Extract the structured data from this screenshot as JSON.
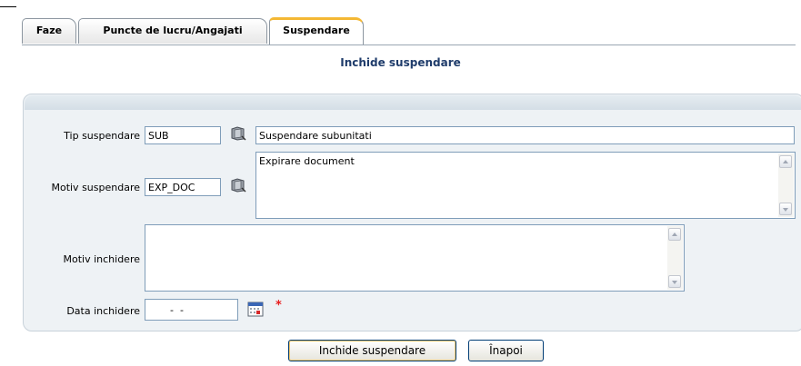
{
  "tabs": [
    {
      "label": "Faze",
      "active": false
    },
    {
      "label": "Puncte de lucru/Angajati",
      "active": false
    },
    {
      "label": "Suspendare",
      "active": true
    }
  ],
  "page_title": "Inchide suspendare",
  "form": {
    "tip_suspendare": {
      "label": "Tip suspendare",
      "code": "SUB",
      "description": "Suspendare subunitati",
      "icon": "lookup-book-icon"
    },
    "motiv_suspendare": {
      "label": "Motiv suspendare",
      "code": "EXP_DOC",
      "description": "Expirare document",
      "icon": "lookup-book-icon"
    },
    "motiv_inchidere": {
      "label": "Motiv inchidere",
      "value": ""
    },
    "data_inchidere": {
      "label": "Data inchidere",
      "value": "  -  -",
      "icon": "calendar-icon",
      "required_mark": "*"
    }
  },
  "buttons": {
    "close_label": "Inchide suspendare",
    "back_label": "Înapoi"
  },
  "colors": {
    "active_tab_accent": "#f4b834",
    "title": "#1f3c6b",
    "required": "#e81b1b",
    "panel_bg": "#eef2f5"
  }
}
